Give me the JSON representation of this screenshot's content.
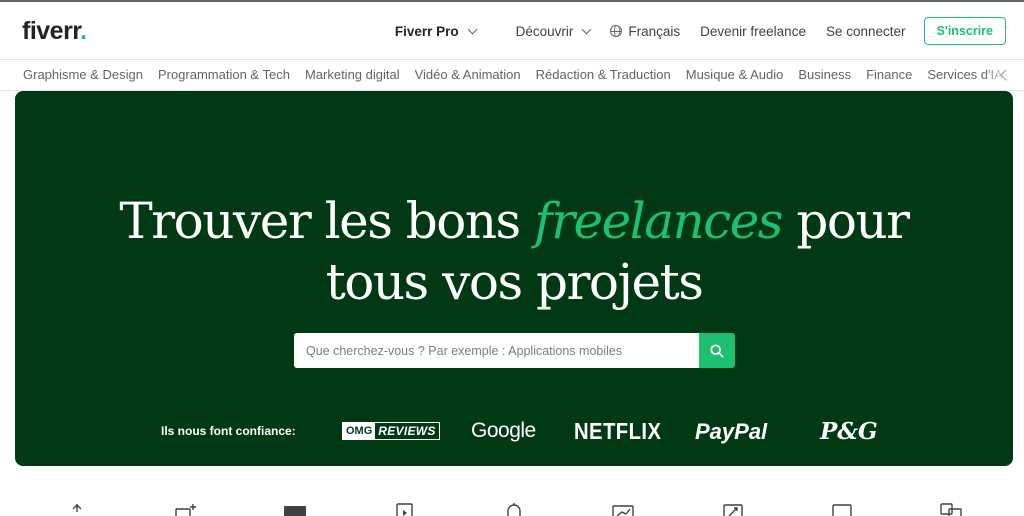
{
  "header": {
    "logo_text": "fiverr",
    "logo_dot": ".",
    "nav": {
      "pro": "Fiverr Pro",
      "discover": "Découvrir",
      "language": "Français",
      "become_seller": "Devenir freelance",
      "sign_in": "Se connecter",
      "join": "S'inscrire"
    }
  },
  "categories": [
    "Graphisme & Design",
    "Programmation & Tech",
    "Marketing digital",
    "Vidéo & Animation",
    "Rédaction & Traduction",
    "Musique & Audio",
    "Business",
    "Finance",
    "Services d'IA"
  ],
  "hero": {
    "title_part1": "Trouver les bons ",
    "title_accent": "freelances",
    "title_part2": " pour",
    "title_line2": "tous vos projets",
    "search_placeholder": "Que cherchez-vous ? Par exemple : Applications mobiles",
    "trusted_label": "Ils nous font confiance:",
    "brands": {
      "omg_a": "OMG",
      "omg_b": "REVIEWS",
      "google": "Google",
      "netflix": "NETFLIX",
      "paypal": "PayPal",
      "pg": "P&G"
    }
  },
  "colors": {
    "brand_green": "#1dbf73",
    "hero_bg": "#013914",
    "text": "#404145"
  },
  "icons": [
    "chevron-down-icon",
    "globe-icon",
    "search-icon",
    "chevron-right-icon"
  ]
}
